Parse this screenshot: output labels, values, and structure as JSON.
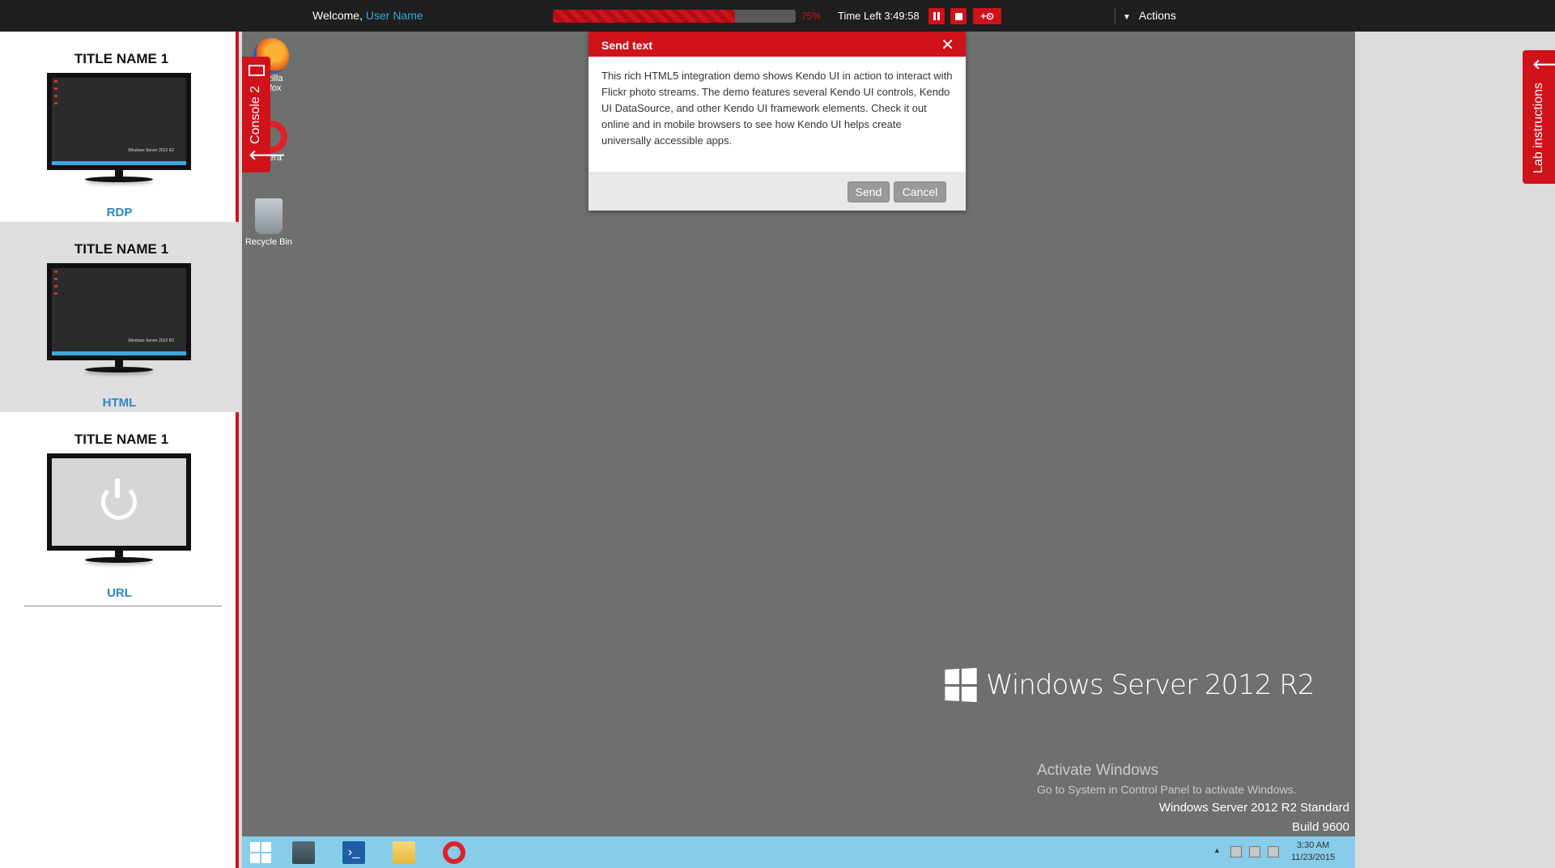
{
  "topbar": {
    "welcome_prefix": "Welcome,",
    "user_name": "User Name",
    "progress_percent": 75,
    "progress_label": "75%",
    "time_left": "Time Left 3:49:58",
    "extend_label": "+⏲",
    "actions_label": "Actions"
  },
  "sidebar": {
    "vms": [
      {
        "title": "TITLE NAME 1",
        "type": "RDP"
      },
      {
        "title": "TITLE NAME 1",
        "type": "HTML"
      },
      {
        "title": "TITLE NAME 1",
        "type": "URL"
      }
    ],
    "screen_caption": "Windows Server 2012 R2"
  },
  "console_tab": {
    "label": "Console 2"
  },
  "desktop": {
    "icons": [
      {
        "label": "zilla\nfox"
      },
      {
        "label": "era"
      },
      {
        "label": "Recycle Bin"
      }
    ],
    "brand": "Windows Server 2012 R2",
    "activate_title": "Activate Windows",
    "activate_sub": "Go to System in Control Panel to activate Windows.",
    "edition": "Windows Server 2012 R2 Standard",
    "build": "Build 9600"
  },
  "dialog": {
    "title": "Send text",
    "body": "This rich HTML5 integration demo shows Kendo UI in action to interact with Flickr photo streams. The demo features several Kendo UI controls, Kendo UI DataSource, and other Kendo UI framework elements. Check it out online and in mobile browsers to see how Kendo UI helps create universally accessible apps.",
    "send_label": "Send",
    "cancel_label": "Cancel"
  },
  "taskbar": {
    "time": "3:30 AM",
    "date": "11/23/2015"
  },
  "lab_tab": {
    "label": "Lab instructions"
  },
  "colors": {
    "accent": "#d0121b",
    "link": "#3aa8e0",
    "taskbar": "#87cde9"
  }
}
